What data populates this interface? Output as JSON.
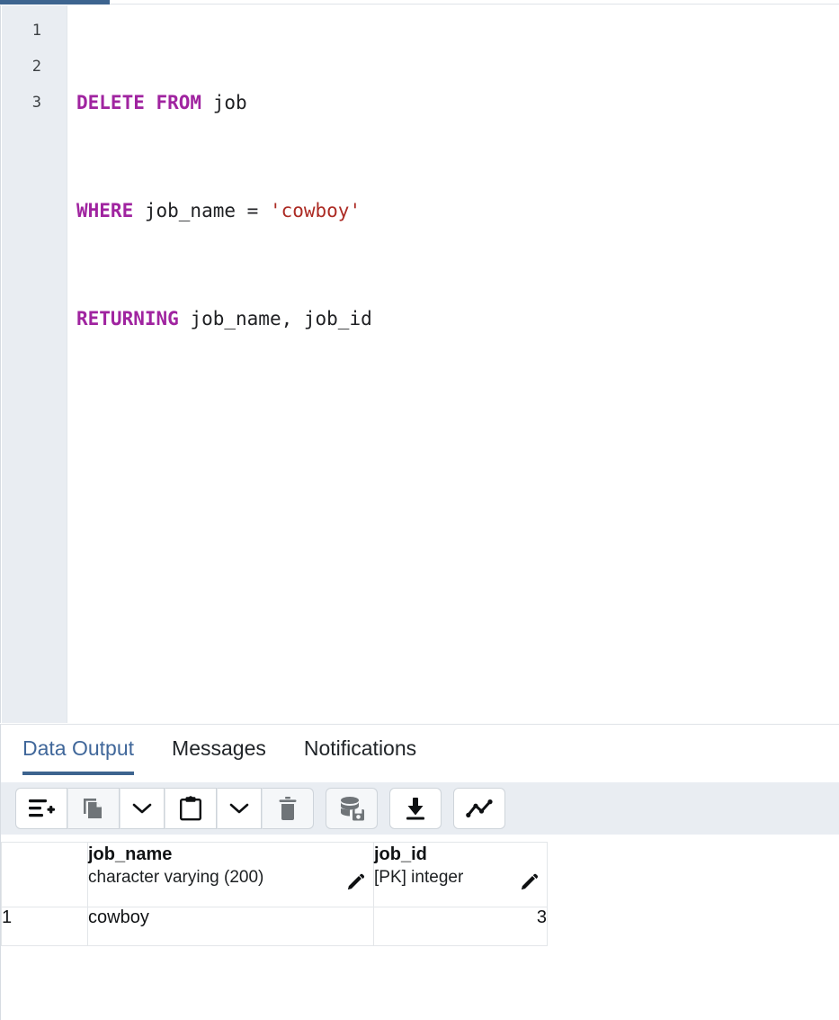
{
  "window": {
    "top_tab_active": true
  },
  "editor": {
    "gutter_numbers": [
      "1",
      "2",
      "3"
    ],
    "lines": [
      [
        {
          "t": "kw",
          "v": "DELETE FROM"
        },
        {
          "t": "pln",
          "v": " job"
        }
      ],
      [
        {
          "t": "kw",
          "v": "WHERE"
        },
        {
          "t": "pln",
          "v": " job_name = "
        },
        {
          "t": "str",
          "v": "'cowboy'"
        }
      ],
      [
        {
          "t": "kw",
          "v": "RETURNING"
        },
        {
          "t": "pln",
          "v": " job_name, job_id"
        }
      ]
    ],
    "plain_text": "DELETE FROM job\nWHERE job_name = 'cowboy'\nRETURNING job_name, job_id"
  },
  "bottom_panel": {
    "tabs": [
      {
        "label": "Data Output",
        "active": true
      },
      {
        "label": "Messages",
        "active": false
      },
      {
        "label": "Notifications",
        "active": false
      }
    ],
    "toolbar": {
      "groups": [
        {
          "buttons": [
            {
              "name": "add-row-button",
              "icon": "add-row-icon",
              "enabled": true
            },
            {
              "name": "copy-button",
              "icon": "copy-icon",
              "enabled": false
            },
            {
              "name": "copy-options-button",
              "icon": "chevron-down-icon",
              "enabled": true
            },
            {
              "name": "paste-button",
              "icon": "clipboard-icon",
              "enabled": true
            },
            {
              "name": "paste-options-button",
              "icon": "chevron-down-icon",
              "enabled": true
            },
            {
              "name": "delete-row-button",
              "icon": "trash-icon",
              "enabled": false
            }
          ]
        },
        {
          "buttons": [
            {
              "name": "save-data-changes-button",
              "icon": "database-save-icon",
              "enabled": false
            }
          ]
        },
        {
          "buttons": [
            {
              "name": "download-results-button",
              "icon": "download-icon",
              "enabled": true
            }
          ]
        },
        {
          "buttons": [
            {
              "name": "graph-visualiser-button",
              "icon": "line-chart-icon",
              "enabled": true
            }
          ]
        }
      ]
    },
    "result_grid": {
      "columns": [
        {
          "name": "",
          "type": "",
          "rownum": true
        },
        {
          "name": "job_name",
          "type": "character varying (200)",
          "align": "left"
        },
        {
          "name": "job_id",
          "type": "[PK] integer",
          "align": "right"
        }
      ],
      "rows": [
        {
          "rownum": "1",
          "job_name": "cowboy",
          "job_id": "3"
        }
      ]
    }
  },
  "colors": {
    "accent_blue": "#3d648f",
    "tab_active_text": "#40679a",
    "keyword_purple": "#a024a0",
    "string_red": "#ac2b24",
    "gutter_bg": "#e9edf2",
    "toolbar_bg": "#e9edf2",
    "grid_border": "#e3e6e9",
    "icon_disabled": "#6f7478"
  }
}
